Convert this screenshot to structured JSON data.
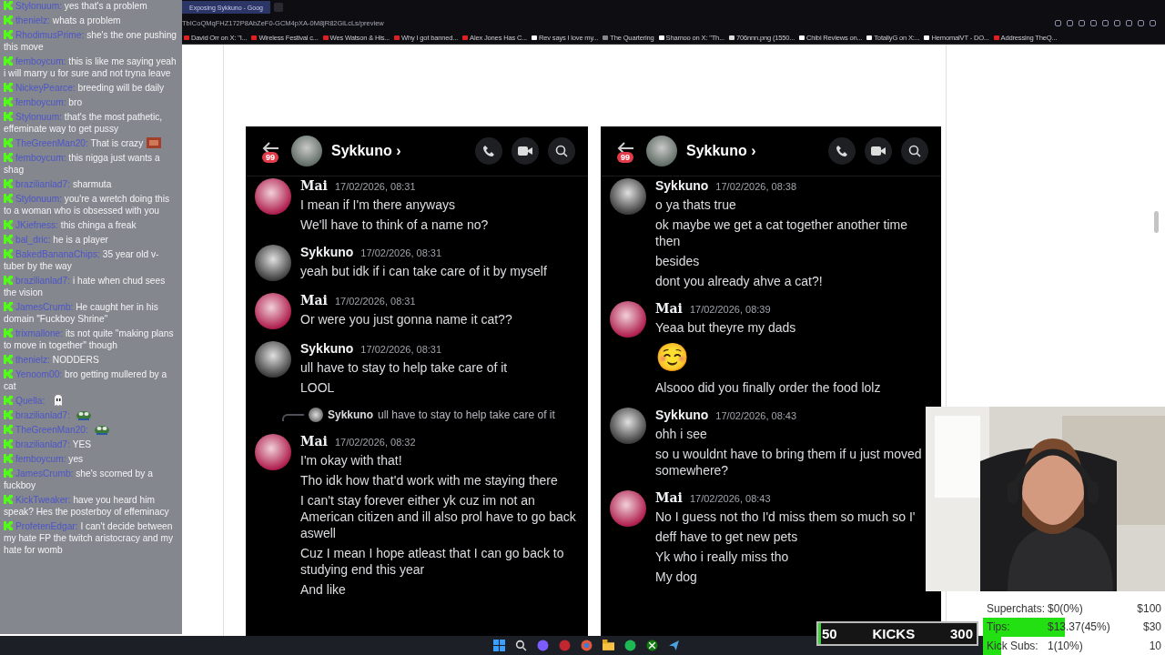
{
  "browser": {
    "tab_title": "Exposing Sykkuno - Goog",
    "url": "TbICoQMqFHZ172P8AbZeF0-GCM4pXA-0M8jR82GiLcLs/preview",
    "bookmarks": [
      "David Orr on X: \"I...",
      "Wireless Festival c...",
      "Wes Watson & His...",
      "Why I got banned...",
      "Alex Jones Has C...",
      "Rev says I love my...",
      "The Quartering",
      "Shamoo on X: \"Th...",
      "706nnn.png (1550...",
      "Chibi Reviews on...",
      "TotallyG on X:...",
      "HemomalVT - DO...",
      "Addressing TheQ..."
    ]
  },
  "chat": {
    "messages": [
      {
        "user": "Stylonuum:",
        "text": "yes that's a problem"
      },
      {
        "user": "thenielz:",
        "text": "whats a problem"
      },
      {
        "user": "RhodimusPrime:",
        "text": "she's the one pushing this move"
      },
      {
        "user": "femboycum:",
        "text": "this is like me saying yeah i will marry u for sure and not tryna leave"
      },
      {
        "user": "NickeyPearce:",
        "text": "breeding will be daily"
      },
      {
        "user": "femboycum:",
        "text": "bro"
      },
      {
        "user": "Stylonuum:",
        "text": "that's the most pathetic, effeminate way to get pussy"
      },
      {
        "user": "TheGreenMan20:",
        "text": "That is crazy",
        "emote": {
          "kind": "face"
        }
      },
      {
        "user": "femboycum:",
        "text": "this nigga just wants a shag"
      },
      {
        "user": "brazilianlad7:",
        "text": "sharmuta"
      },
      {
        "user": "Stylonuum:",
        "text": "you're a wretch doing this to a woman who is obsessed with you"
      },
      {
        "user": "JKiefness:",
        "text": "this chinga a freak"
      },
      {
        "user": "bal_dric:",
        "text": "he is a player"
      },
      {
        "user": "BakedBananaChips:",
        "text": "35 year old v-tuber by the way"
      },
      {
        "user": "brazilianlad7:",
        "text": "i hate when chud sees the vision"
      },
      {
        "user": "JamesCrumb:",
        "text": "He caught her in his domain \"Fuckboy Shrine\""
      },
      {
        "user": "trixmallone:",
        "text": "its not quite \"making plans to move in together\" though"
      },
      {
        "user": "thenielz:",
        "text": "NODDERS"
      },
      {
        "user": "Yenoom00:",
        "text": "bro getting mullered by a cat"
      },
      {
        "user": "Quella:",
        "emote": {
          "kind": "ghost"
        }
      },
      {
        "user": "brazilianlad7:",
        "emote": {
          "kind": "frog"
        }
      },
      {
        "user": "TheGreenMan20:",
        "emote": {
          "kind": "frog"
        }
      },
      {
        "user": "brazilianlad7:",
        "text": "YES"
      },
      {
        "user": "femboycum:",
        "text": "yes"
      },
      {
        "user": "JamesCrumb:",
        "text": "she's scorned by a fuckboy"
      },
      {
        "user": "KickTweaker:",
        "text": "have you heard him speak? Hes the posterboy of effeminacy"
      },
      {
        "user": "ProfetenEdgar:",
        "text": "I can't decide between my hate FP the twitch aristocracy and my hate for womb"
      }
    ]
  },
  "screenshots": [
    {
      "contact": "Sykkuno",
      "chevron": "›",
      "badge": "99",
      "messages": [
        {
          "author": "Mai",
          "time": "17/02/2026, 08:31",
          "lines": [
            "I mean if I'm there anyways",
            "We'll have to think of a name no?"
          ]
        },
        {
          "author": "Sykkuno",
          "time": "17/02/2026, 08:31",
          "lines": [
            "yeah but idk if i can take care of it by myself"
          ]
        },
        {
          "author": "Mai",
          "time": "17/02/2026, 08:31",
          "lines": [
            "Or were you just gonna name it cat??"
          ]
        },
        {
          "author": "Sykkuno",
          "time": "17/02/2026, 08:31",
          "lines": [
            "ull have to stay to help take care of it",
            "LOOL"
          ]
        },
        {
          "author": "Mai",
          "time": "17/02/2026, 08:32",
          "reply": {
            "author": "Sykkuno",
            "text": "ull have to stay to help take care of it"
          },
          "lines": [
            "I'm okay with that!",
            "Tho idk how that'd work with me staying there",
            "I can't stay forever either yk cuz im not an American citizen and ill also prol have to go back aswell",
            "Cuz I mean I hope atleast that I can go back to studying end this year",
            "And like"
          ]
        }
      ]
    },
    {
      "contact": "Sykkuno",
      "chevron": "›",
      "badge": "99",
      "messages": [
        {
          "author": "Sykkuno",
          "time": "17/02/2026, 08:38",
          "lines": [
            "o ya thats true",
            "ok maybe we get a cat together another time then",
            "besides",
            "dont you already ahve a cat?!"
          ]
        },
        {
          "author": "Mai",
          "time": "17/02/2026, 08:39",
          "lines": [
            "Yeaa but theyre my dads"
          ],
          "emoji": "☺️",
          "after": [
            "Alsooo did you finally order the food lolz"
          ]
        },
        {
          "author": "Sykkuno",
          "time": "17/02/2026, 08:43",
          "lines": [
            "ohh i see",
            "so u wouldnt have to bring them if u just moved somewhere?"
          ]
        },
        {
          "author": "Mai",
          "time": "17/02/2026, 08:43",
          "lines": [
            "No I guess not tho I'd miss them so much so I'",
            "deff have to get new pets",
            "Yk who i really miss tho",
            "My dog"
          ]
        }
      ]
    }
  ],
  "kicks_goal": {
    "start": "50",
    "label": "KICKS",
    "end": "300",
    "level": 0.02
  },
  "goals": [
    {
      "label": "Superchats:",
      "amount": "$0(0%)",
      "target": "$100"
    },
    {
      "label": "Tips:",
      "amount": "$13.37(45%)",
      "target": "$30",
      "level": 0.45
    },
    {
      "label": "Kick Subs:",
      "amount": "1(10%)",
      "target": "10",
      "level": 0.1
    }
  ]
}
